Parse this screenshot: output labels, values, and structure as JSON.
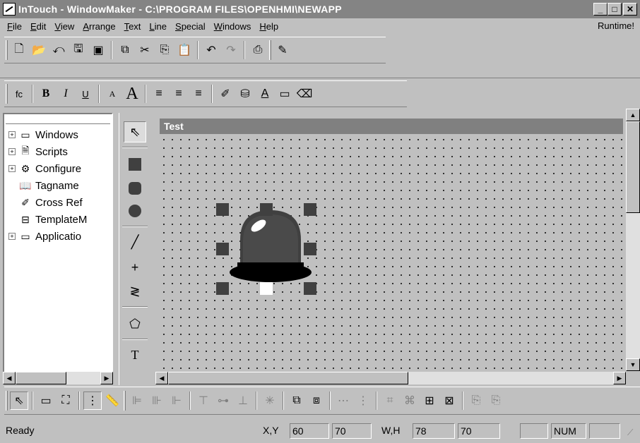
{
  "window": {
    "title": "InTouch - WindowMaker - C:\\PROGRAM FILES\\OPENHMI\\NEWAPP",
    "minimize": "_",
    "maximize": "□",
    "close": "✕"
  },
  "menu": {
    "items": [
      {
        "underline": "F",
        "rest": "ile"
      },
      {
        "underline": "E",
        "rest": "dit"
      },
      {
        "underline": "V",
        "rest": "iew"
      },
      {
        "underline": "A",
        "rest": "rrange"
      },
      {
        "underline": "T",
        "rest": "ext"
      },
      {
        "underline": "L",
        "rest": "ine"
      },
      {
        "underline": "S",
        "rest": "pecial"
      },
      {
        "underline": "W",
        "rest": "indows"
      },
      {
        "underline": "H",
        "rest": "elp"
      }
    ],
    "runtime": "Runtime!"
  },
  "toolbar1": {
    "icons": [
      "new-file",
      "open-folder",
      "import",
      "save",
      "save-all",
      "duplicate",
      "cut",
      "copy",
      "paste",
      "undo",
      "redo",
      "print",
      "wizard"
    ]
  },
  "toolbar2": {
    "font_icon": "fc",
    "bold": "B",
    "italic": "I",
    "underline": "U",
    "font_small": "A",
    "font_large": "A"
  },
  "tree": {
    "items": [
      {
        "label": "Windows",
        "expander": "+"
      },
      {
        "label": "Scripts",
        "expander": "+"
      },
      {
        "label": "Configure",
        "expander": "+"
      },
      {
        "label": "Tagname",
        "expander": ""
      },
      {
        "label": "Cross Ref",
        "expander": ""
      },
      {
        "label": "TemplateM",
        "expander": ""
      },
      {
        "label": "Applicatio",
        "expander": "+"
      }
    ]
  },
  "canvas": {
    "window_title": "Test"
  },
  "tools": {
    "text_tool": "T"
  },
  "status": {
    "ready": "Ready",
    "xy_label": "X,Y",
    "x": "60",
    "y": "70",
    "wh_label": "W,H",
    "w": "78",
    "h": "70",
    "num": "NUM"
  },
  "colors": {
    "titlebar_inactive": "#848484",
    "child_titlebar": "#808080",
    "face": "#c0c0c0",
    "handle": "#404040"
  }
}
